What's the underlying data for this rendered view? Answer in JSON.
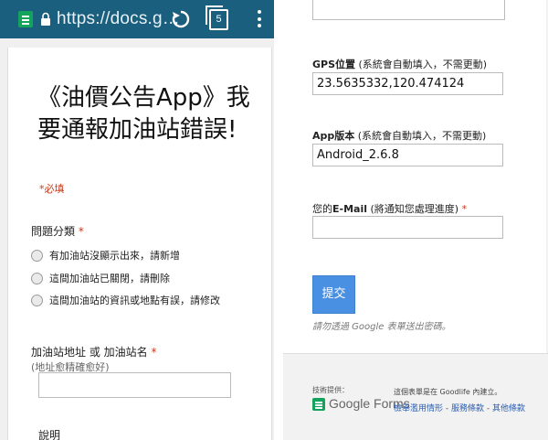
{
  "browser": {
    "url": "https://docs.g…",
    "tab_count": "5"
  },
  "form": {
    "title": "《油價公告App》我要通報加油站錯誤!",
    "required_note": "*必填",
    "question_category": {
      "label": "問題分類",
      "required_mark": "*",
      "options": [
        "有加油站沒顯示出來，請新增",
        "這間加油站已關閉，請刪除",
        "這間加油站的資訊或地點有誤，請修改"
      ]
    },
    "station": {
      "label": "加油站地址 或 加油站名",
      "required_mark": "*",
      "helper": "(地址愈精確愈好)",
      "value": ""
    },
    "description_label": "說明"
  },
  "right": {
    "gps": {
      "label_bold": "GPS位置",
      "label_rest": " (系統會自動填入，不需更動)",
      "value": "23.5635332,120.474124"
    },
    "app_version": {
      "label_bold": "App版本",
      "label_rest": " (系統會自動填入，不需更動)",
      "value": "Android_2.6.8"
    },
    "email": {
      "label_prefix": "您的",
      "label_bold": "E-Mail",
      "label_rest": " (將通知您處理進度)",
      "required_mark": "*",
      "value": ""
    },
    "submit_label": "提交",
    "password_warning": "請勿透過 Google 表單送出密碼。",
    "footer": {
      "powered_by": "技術提供：",
      "google_forms": "Google Forms",
      "created_in": "這個表單是在 Goodlife 內建立。",
      "report_abuse": "檢舉濫用情形",
      "terms": "服務條款",
      "other_terms": "其他條款",
      "separator": " - "
    }
  },
  "colors": {
    "browser_bar": "#1b5f7e",
    "required_red": "#c43b1d",
    "submit_blue": "#4a90e2",
    "forms_green": "#14a35c",
    "link_blue": "#2a5db0"
  }
}
